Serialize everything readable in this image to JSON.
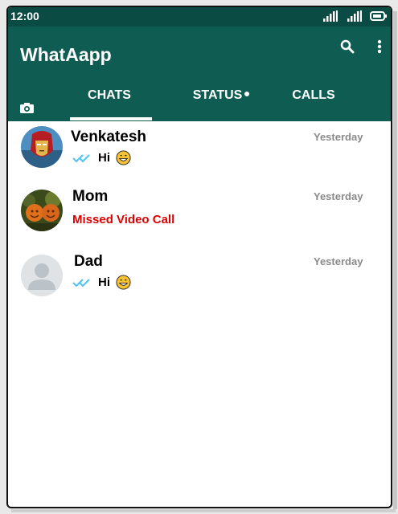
{
  "status_bar": {
    "time": "12:00"
  },
  "header": {
    "title": "WhatAapp"
  },
  "tabs": [
    {
      "label": "CHATS",
      "active": true
    },
    {
      "label": "STATUS",
      "has_dot": true
    },
    {
      "label": "CALLS"
    }
  ],
  "chats": [
    {
      "name": "Venkatesh",
      "time": "Yesterday",
      "message": "Hi",
      "read": true
    },
    {
      "name": "Mom",
      "time": "Yesterday",
      "message": "Missed Video Call",
      "missed_call": true
    },
    {
      "name": "Dad",
      "time": "Yesterday",
      "message": "Hi",
      "read": true
    }
  ],
  "colors": {
    "status_bar": "#0a4c43",
    "app_bar": "#0f5d52",
    "missed_call": "#e00000",
    "read_ticks": "#4fc3f7",
    "timestamp": "#8a8a8a"
  },
  "icons": [
    "signal-icon",
    "battery-icon",
    "search-icon",
    "more-options-icon",
    "camera-icon",
    "double-tick-icon",
    "grinning-emoji-icon"
  ]
}
